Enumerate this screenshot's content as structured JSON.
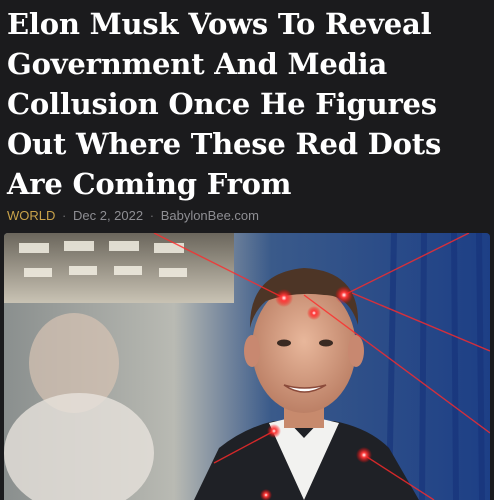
{
  "article": {
    "headline_lines": [
      "Elon Musk Vows To Reveal",
      "Government And Media",
      "Collusion Once He Figures",
      "Out Where These Red Dots",
      "Are Coming From"
    ],
    "category": "WORLD",
    "separator": "·",
    "date": "Dec 2, 2022",
    "source": "BabylonBee.com"
  },
  "image": {
    "icon": "photo-man-with-red-laser-dots"
  },
  "colors": {
    "background": "#1b1b1d",
    "headline": "#ffffff",
    "meta": "#8e8e93",
    "category": "#c8a24a",
    "laser": "#ff2a2a"
  }
}
